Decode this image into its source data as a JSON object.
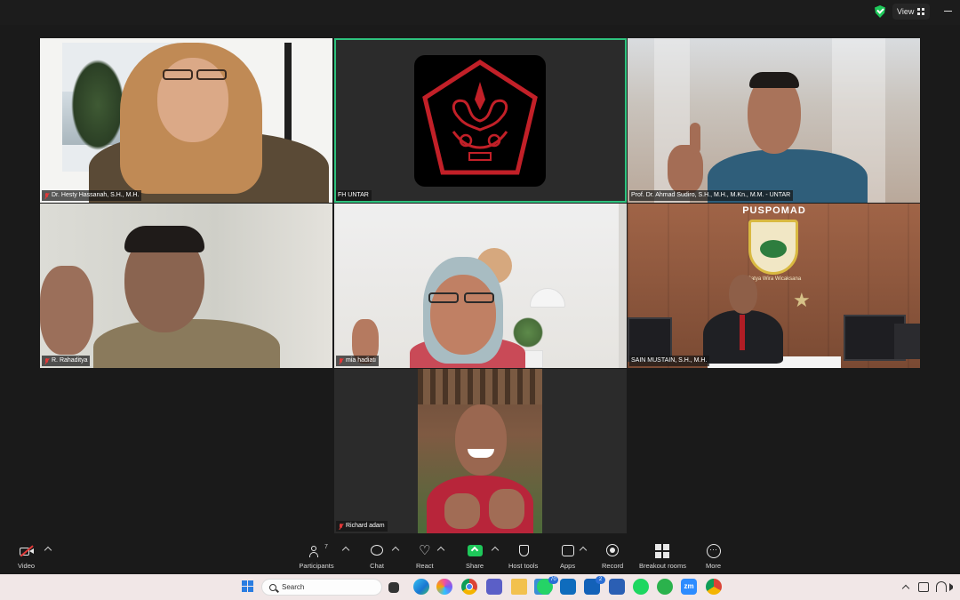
{
  "window": {
    "view_label": "View"
  },
  "participants": [
    {
      "name": "Dr. Hesty Hassanah, S.H., M.H."
    },
    {
      "name": "FH UNTAR"
    },
    {
      "name": "Prof. Dr. Ahmad Sudiro, S.H., M.H., M.Kn., M.M. - UNTAR"
    },
    {
      "name": "R. Rahaditya"
    },
    {
      "name": "mia hadiati"
    },
    {
      "name": "SAIN MUSTAIN, S.H., M.H."
    },
    {
      "name": "Richard adam"
    }
  ],
  "backgrounds": {
    "puspomad_banner": "PUSPOMAD",
    "emblem_motto": "Satya Wira Wicaksana"
  },
  "toolbar": {
    "video": "Video",
    "participants": "Participants",
    "participants_count": "7",
    "chat": "Chat",
    "react": "React",
    "share": "Share",
    "host_tools": "Host tools",
    "apps": "Apps",
    "record": "Record",
    "breakout": "Breakout rooms",
    "more": "More"
  },
  "taskbar": {
    "search_placeholder": "Search",
    "whatsapp_badge": "70",
    "l_badge": "2",
    "zoom_label": "zm"
  },
  "colors": {
    "active_speaker": "#2ec27e",
    "muted": "#e23838",
    "share": "#1ec85a"
  }
}
